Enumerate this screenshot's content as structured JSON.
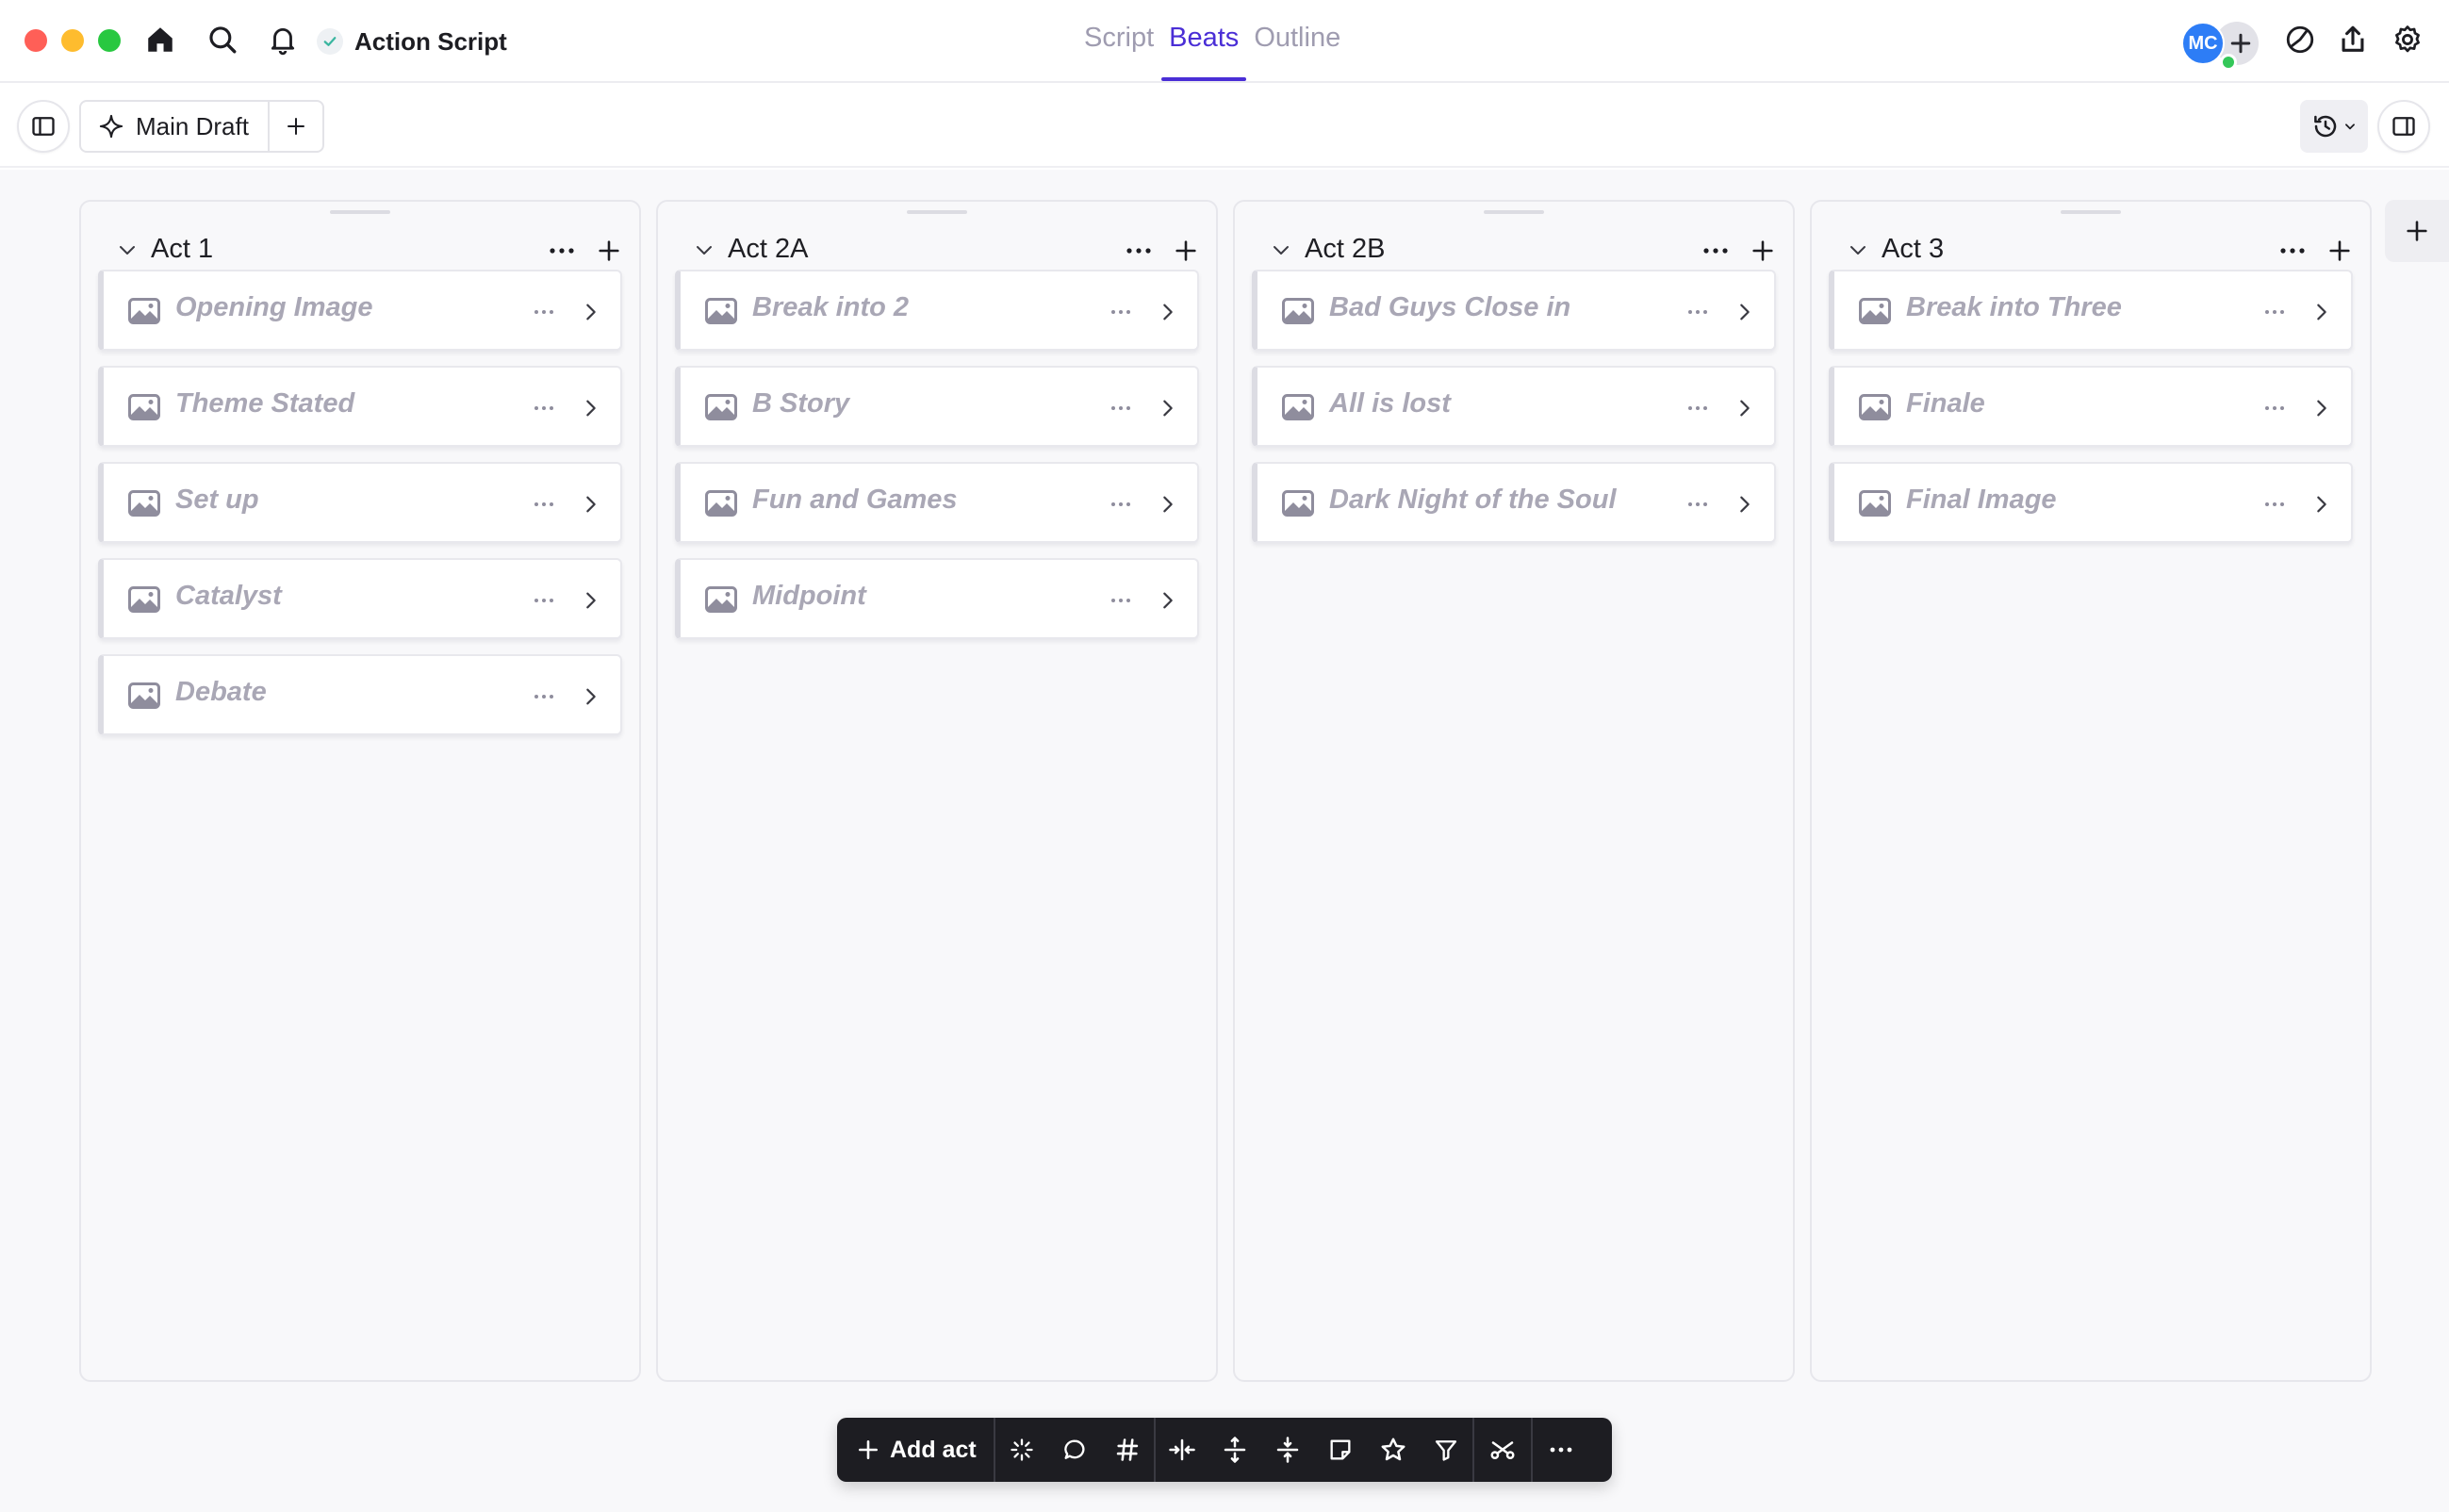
{
  "app": {
    "document_title": "Action Script",
    "view_tabs": [
      {
        "label": "Script",
        "active": false
      },
      {
        "label": "Beats",
        "active": true
      },
      {
        "label": "Outline",
        "active": false
      }
    ],
    "user_initials": "MC",
    "accent_color": "#4a2ed6",
    "avatar_color": "#2d7df6"
  },
  "toolbar": {
    "draft_label": "Main Draft"
  },
  "board": {
    "acts": [
      {
        "title": "Act 1",
        "beats": [
          "Opening Image",
          "Theme Stated",
          "Set up",
          "Catalyst",
          "Debate"
        ]
      },
      {
        "title": "Act 2A",
        "beats": [
          "Break into 2",
          "B Story",
          "Fun and Games",
          "Midpoint"
        ]
      },
      {
        "title": "Act 2B",
        "beats": [
          "Bad Guys Close in",
          "All is lost",
          "Dark Night of the Soul"
        ]
      },
      {
        "title": "Act 3",
        "beats": [
          "Break into Three",
          "Finale",
          "Final Image"
        ]
      }
    ]
  },
  "bottom_bar": {
    "add_act_label": "Add act",
    "tools": [
      "sparkle-icon",
      "comment-icon",
      "hashtag-icon",
      "collapse-horizontal-icon",
      "expand-vertical-icon",
      "collapse-vertical-icon",
      "note-icon",
      "star-icon",
      "filter-icon",
      "cut-icon",
      "more-icon"
    ]
  }
}
